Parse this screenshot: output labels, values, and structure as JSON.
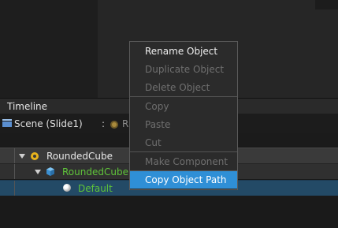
{
  "timeline": {
    "title": "Timeline"
  },
  "scene": {
    "label": "Scene (Slide1)",
    "colon": ":",
    "object_text": "R"
  },
  "tree": [
    {
      "label": "RoundedCube"
    },
    {
      "label": "RoundedCube"
    },
    {
      "label": "Default"
    }
  ],
  "context_menu": {
    "items": [
      {
        "label": "Rename Object",
        "enabled": true
      },
      {
        "label": "Duplicate Object",
        "enabled": false
      },
      {
        "label": "Delete Object",
        "enabled": false
      },
      {
        "label": "Copy",
        "enabled": false
      },
      {
        "label": "Paste",
        "enabled": false
      },
      {
        "label": "Cut",
        "enabled": false
      },
      {
        "label": "Make Component",
        "enabled": false
      },
      {
        "label": "Copy Object Path",
        "enabled": true,
        "selected": true
      }
    ]
  },
  "colors": {
    "selection": "#2f8fd6",
    "material_text": "#5fc43a",
    "row_selected": "#234a66"
  }
}
